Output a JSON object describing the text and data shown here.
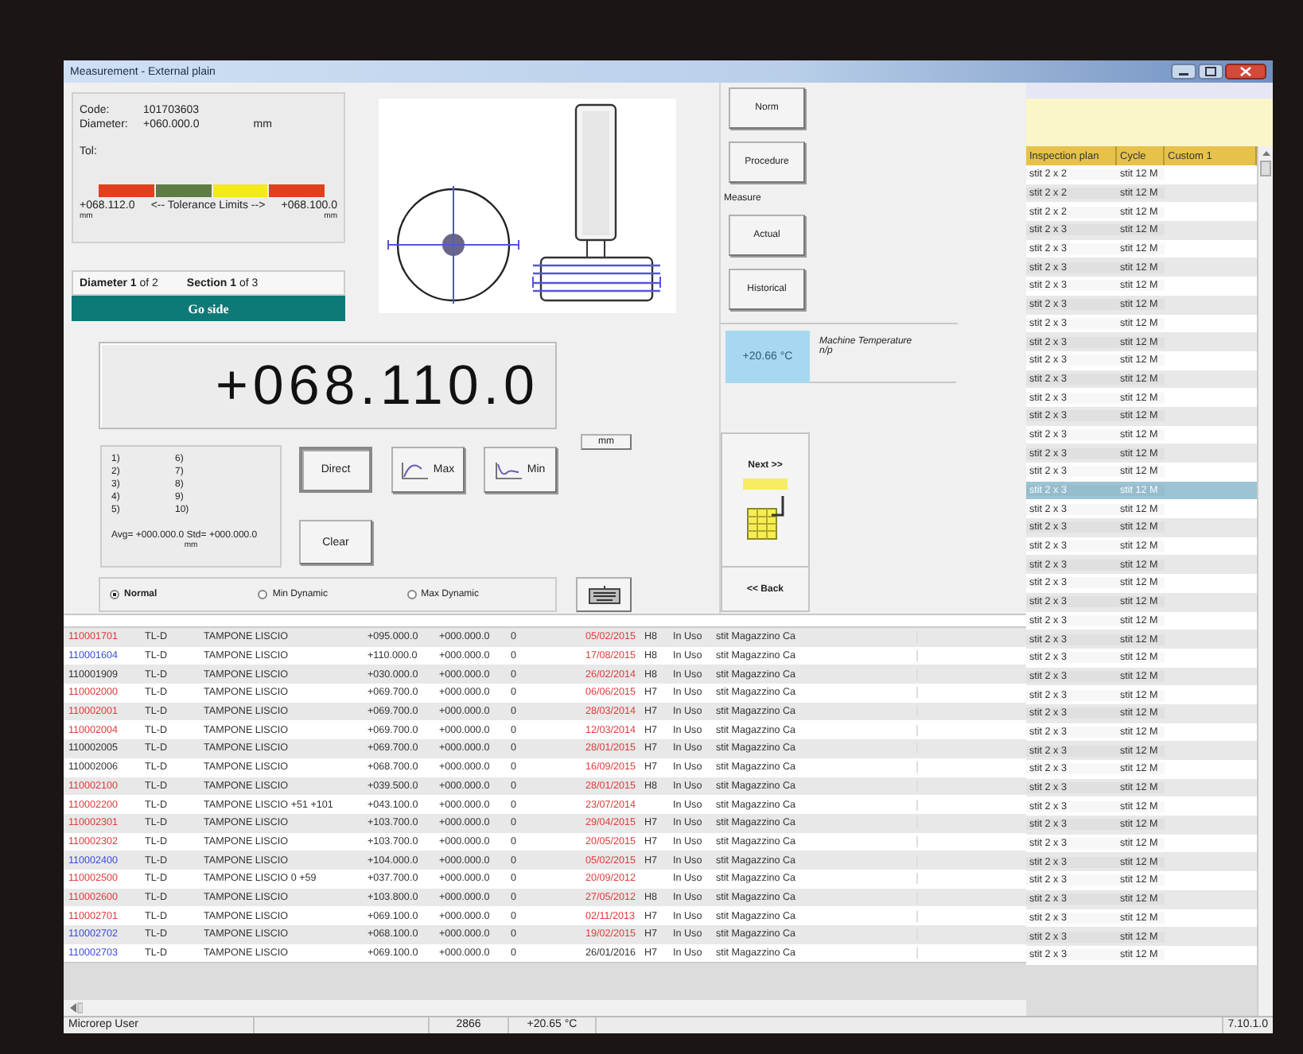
{
  "window": {
    "title": "Measurement - External plain"
  },
  "part": {
    "code_label": "Code:",
    "code": "101703603",
    "diameter_label": "Diameter:",
    "diameter": "+060.000.0",
    "unit": "mm",
    "tol_label": "Tol:"
  },
  "tolerance": {
    "lower": "+068.112.0",
    "lower_unit": "mm",
    "caption": "<-- Tolerance Limits -->",
    "upper": "+068.100.0",
    "upper_unit": "mm",
    "segments": [
      {
        "color": "#e0401c"
      },
      {
        "color": "#5e7c44"
      },
      {
        "color": "#f2ea1a"
      },
      {
        "color": "#e0401c"
      }
    ]
  },
  "position": {
    "diameter": "**Diameter 1** of 2",
    "section": "**Section 1** of 3"
  },
  "side": "Go side",
  "reading": "+068.110.0",
  "unit_button": "mm",
  "readings": {
    "slots": [
      "1)",
      "2)",
      "3)",
      "4)",
      "5)",
      "6)",
      "7)",
      "8)",
      "9)",
      "10)"
    ],
    "summary": "Avg= +000.000.0  Std= +000.000.0",
    "unit": "mm"
  },
  "mode_buttons": [
    {
      "label": "Direct",
      "kind": "plain",
      "selected": true
    },
    {
      "label": "Max",
      "kind": "max",
      "selected": false
    },
    {
      "label": "Min",
      "kind": "min",
      "selected": false
    },
    {
      "label": "Clear",
      "kind": "plain",
      "selected": false
    }
  ],
  "dynamics": [
    {
      "label": "Normal",
      "selected": true
    },
    {
      "label": "Min Dynamic",
      "selected": false
    },
    {
      "label": "Max Dynamic",
      "selected": false
    }
  ],
  "nav": [
    {
      "kind": "button",
      "label": "Norm"
    },
    {
      "kind": "button",
      "label": "Procedure"
    },
    {
      "kind": "label",
      "label": "Measure"
    },
    {
      "kind": "button",
      "label": "Actual"
    },
    {
      "kind": "button",
      "label": "Historical"
    }
  ],
  "temperature": {
    "value": "+20.66 °C",
    "label": "Machine Temperature",
    "note": "n/p"
  },
  "next": "Next >>",
  "back": "<< Back",
  "table": {
    "rows": [
      {
        "column_1": "110001701",
        "color": "#e03a3a",
        "column_2": "TL-D",
        "column_3": "TAMPONE LISCIO",
        "column_4": "+095.000.0",
        "column_5": "+000.000.0",
        "column_6": "0",
        "column_7": "05/02/2015",
        "expired": true,
        "column_8": "H8",
        "column_9": "In Uso",
        "column_10": "stit Magazzino Ca"
      },
      {
        "column_1": "110001604",
        "color": "#3a4ae0",
        "column_2": "TL-D",
        "column_3": "TAMPONE LISCIO",
        "column_4": "+110.000.0",
        "column_5": "+000.000.0",
        "column_6": "0",
        "column_7": "17/08/2015",
        "expired": true,
        "column_8": "H8",
        "column_9": "In Uso",
        "column_10": "stit Magazzino Ca"
      },
      {
        "column_1": "110001909",
        "color": "#333333",
        "column_2": "TL-D",
        "column_3": "TAMPONE LISCIO",
        "column_4": "+030.000.0",
        "column_5": "+000.000.0",
        "column_6": "0",
        "column_7": "26/02/2014",
        "expired": true,
        "column_8": "H8",
        "column_9": "In Uso",
        "column_10": "stit Magazzino Ca"
      },
      {
        "column_1": "110002000",
        "color": "#e03a3a",
        "column_2": "TL-D",
        "column_3": "TAMPONE LISCIO",
        "column_4": "+069.700.0",
        "column_5": "+000.000.0",
        "column_6": "0",
        "column_7": "06/06/2015",
        "expired": true,
        "column_8": "H7",
        "column_9": "In Uso",
        "column_10": "stit Magazzino Ca"
      },
      {
        "column_1": "110002001",
        "color": "#e03a3a",
        "column_2": "TL-D",
        "column_3": "TAMPONE LISCIO",
        "column_4": "+069.700.0",
        "column_5": "+000.000.0",
        "column_6": "0",
        "column_7": "28/03/2014",
        "expired": true,
        "column_8": "H7",
        "column_9": "In Uso",
        "column_10": "stit Magazzino Ca"
      },
      {
        "column_1": "110002004",
        "color": "#e03a3a",
        "column_2": "TL-D",
        "column_3": "TAMPONE LISCIO",
        "column_4": "+069.700.0",
        "column_5": "+000.000.0",
        "column_6": "0",
        "column_7": "12/03/2014",
        "expired": true,
        "column_8": "H7",
        "column_9": "In Uso",
        "column_10": "stit Magazzino Ca"
      },
      {
        "column_1": "110002005",
        "color": "#333333",
        "column_2": "TL-D",
        "column_3": "TAMPONE LISCIO",
        "column_4": "+069.700.0",
        "column_5": "+000.000.0",
        "column_6": "0",
        "column_7": "28/01/2015",
        "expired": true,
        "column_8": "H7",
        "column_9": "In Uso",
        "column_10": "stit Magazzino Ca"
      },
      {
        "column_1": "110002006",
        "color": "#333333",
        "column_2": "TL-D",
        "column_3": "TAMPONE LISCIO",
        "column_4": "+068.700.0",
        "column_5": "+000.000.0",
        "column_6": "0",
        "column_7": "16/09/2015",
        "expired": true,
        "column_8": "H7",
        "column_9": "In Uso",
        "column_10": "stit Magazzino Ca"
      },
      {
        "column_1": "110002100",
        "color": "#e03a3a",
        "column_2": "TL-D",
        "column_3": "TAMPONE LISCIO",
        "column_4": "+039.500.0",
        "column_5": "+000.000.0",
        "column_6": "0",
        "column_7": "28/01/2015",
        "expired": true,
        "column_8": "H8",
        "column_9": "In Uso",
        "column_10": "stit Magazzino Ca"
      },
      {
        "column_1": "110002200",
        "color": "#e03a3a",
        "column_2": "TL-D",
        "column_3": "TAMPONE LISCIO +51 +101",
        "column_4": "+043.100.0",
        "column_5": "+000.000.0",
        "column_6": "0",
        "column_7": "23/07/2014",
        "expired": true,
        "column_9": "In Uso",
        "column_10": "stit Magazzino Ca"
      },
      {
        "column_1": "110002301",
        "color": "#e03a3a",
        "column_2": "TL-D",
        "column_3": "TAMPONE LISCIO",
        "column_4": "+103.700.0",
        "column_5": "+000.000.0",
        "column_6": "0",
        "column_7": "29/04/2015",
        "expired": true,
        "column_8": "H7",
        "column_9": "In Uso",
        "column_10": "stit Magazzino Ca"
      },
      {
        "column_1": "110002302",
        "color": "#e03a3a",
        "column_2": "TL-D",
        "column_3": "TAMPONE LISCIO",
        "column_4": "+103.700.0",
        "column_5": "+000.000.0",
        "column_6": "0",
        "column_7": "20/05/2015",
        "expired": true,
        "column_8": "H7",
        "column_9": "In Uso",
        "column_10": "stit Magazzino Ca"
      },
      {
        "column_1": "110002400",
        "color": "#3a4ae0",
        "column_2": "TL-D",
        "column_3": "TAMPONE LISCIO",
        "column_4": "+104.000.0",
        "column_5": "+000.000.0",
        "column_6": "0",
        "column_7": "05/02/2015",
        "expired": true,
        "column_8": "H7",
        "column_9": "In Uso",
        "column_10": "stit Magazzino Ca"
      },
      {
        "column_1": "110002500",
        "color": "#e03a3a",
        "column_2": "TL-D",
        "column_3": "TAMPONE LISCIO 0 +59",
        "column_4": "+037.700.0",
        "column_5": "+000.000.0",
        "column_6": "0",
        "column_7": "20/09/2012",
        "expired": true,
        "column_9": "In Uso",
        "column_10": "stit Magazzino Ca"
      },
      {
        "column_1": "110002600",
        "color": "#e03a3a",
        "column_2": "TL-D",
        "column_3": "TAMPONE LISCIO",
        "column_4": "+103.800.0",
        "column_5": "+000.000.0",
        "column_6": "0",
        "column_7": "27/05/2012",
        "expired": true,
        "column_8": "H8",
        "column_9": "In Uso",
        "column_10": "stit Magazzino Ca"
      },
      {
        "column_1": "110002701",
        "color": "#e03a3a",
        "column_2": "TL-D",
        "column_3": "TAMPONE LISCIO",
        "column_4": "+069.100.0",
        "column_5": "+000.000.0",
        "column_6": "0",
        "column_7": "02/11/2013",
        "expired": true,
        "column_8": "H7",
        "column_9": "In Uso",
        "column_10": "stit Magazzino Ca"
      },
      {
        "column_1": "110002702",
        "color": "#3a4ae0",
        "column_2": "TL-D",
        "column_3": "TAMPONE LISCIO",
        "column_4": "+068.100.0",
        "column_5": "+000.000.0",
        "column_6": "0",
        "column_7": "19/02/2015",
        "expired": true,
        "column_8": "H7",
        "column_9": "In Uso",
        "column_10": "stit Magazzino Ca"
      },
      {
        "column_1": "110002703",
        "color": "#3a4ae0",
        "column_2": "TL-D",
        "column_3": "TAMPONE LISCIO",
        "column_4": "+069.100.0",
        "column_5": "+000.000.0",
        "column_6": "0",
        "column_7": "26/01/2016",
        "expired": false,
        "column_8": "H7",
        "column_9": "In Uso",
        "column_10": "stit Magazzino Ca"
      }
    ]
  },
  "plan": {
    "columns": [
      "Inspection plan",
      "Cycle",
      "Custom 1"
    ],
    "rows": [
      {
        "plan": "stit 2 x 2",
        "cycle": "stit 12 M",
        "selected": false
      },
      {
        "plan": "stit 2 x 2",
        "cycle": "stit 12 M",
        "selected": false
      },
      {
        "plan": "stit 2 x 2",
        "cycle": "stit 12 M",
        "selected": false
      },
      {
        "plan": "stit 2 x 3",
        "cycle": "stit 12 M",
        "selected": false
      },
      {
        "plan": "stit 2 x 3",
        "cycle": "stit 12 M",
        "selected": false
      },
      {
        "plan": "stit 2 x 3",
        "cycle": "stit 12 M",
        "selected": false
      },
      {
        "plan": "stit 2 x 3",
        "cycle": "stit 12 M",
        "selected": false
      },
      {
        "plan": "stit 2 x 3",
        "cycle": "stit 12 M",
        "selected": false
      },
      {
        "plan": "stit 2 x 3",
        "cycle": "stit 12 M",
        "selected": false
      },
      {
        "plan": "stit 2 x 3",
        "cycle": "stit 12 M",
        "selected": false
      },
      {
        "plan": "stit 2 x 3",
        "cycle": "stit 12 M",
        "selected": false
      },
      {
        "plan": "stit 2 x 3",
        "cycle": "stit 12 M",
        "selected": false
      },
      {
        "plan": "stit 2 x 3",
        "cycle": "stit 12 M",
        "selected": false
      },
      {
        "plan": "stit 2 x 3",
        "cycle": "stit 12 M",
        "selected": false
      },
      {
        "plan": "stit 2 x 3",
        "cycle": "stit 12 M",
        "selected": false
      },
      {
        "plan": "stit 2 x 3",
        "cycle": "stit 12 M",
        "selected": false
      },
      {
        "plan": "stit 2 x 3",
        "cycle": "stit 12 M",
        "selected": false
      },
      {
        "plan": "stit 2 x 3",
        "cycle": "stit 12 M",
        "selected": true
      },
      {
        "plan": "stit 2 x 3",
        "cycle": "stit 12 M",
        "selected": false
      },
      {
        "plan": "stit 2 x 3",
        "cycle": "stit 12 M",
        "selected": false
      },
      {
        "plan": "stit 2 x 3",
        "cycle": "stit 12 M",
        "selected": false
      },
      {
        "plan": "stit 2 x 3",
        "cycle": "stit 12 M",
        "selected": false
      },
      {
        "plan": "stit 2 x 3",
        "cycle": "stit 12 M",
        "selected": false
      },
      {
        "plan": "stit 2 x 3",
        "cycle": "stit 12 M",
        "selected": false
      },
      {
        "plan": "stit 2 x 3",
        "cycle": "stit 12 M",
        "selected": false
      },
      {
        "plan": "stit 2 x 3",
        "cycle": "stit 12 M",
        "selected": false
      },
      {
        "plan": "stit 2 x 3",
        "cycle": "stit 12 M",
        "selected": false
      },
      {
        "plan": "stit 2 x 3",
        "cycle": "stit 12 M",
        "selected": false
      },
      {
        "plan": "stit 2 x 3",
        "cycle": "stit 12 M",
        "selected": false
      },
      {
        "plan": "stit 2 x 3",
        "cycle": "stit 12 M",
        "selected": false
      },
      {
        "plan": "stit 2 x 3",
        "cycle": "stit 12 M",
        "selected": false
      },
      {
        "plan": "stit 2 x 3",
        "cycle": "stit 12 M",
        "selected": false
      },
      {
        "plan": "stit 2 x 3",
        "cycle": "stit 12 M",
        "selected": false
      },
      {
        "plan": "stit 2 x 3",
        "cycle": "stit 12 M",
        "selected": false
      },
      {
        "plan": "stit 2 x 3",
        "cycle": "stit 12 M",
        "selected": false
      },
      {
        "plan": "stit 2 x 3",
        "cycle": "stit 12 M",
        "selected": false
      },
      {
        "plan": "stit 2 x 3",
        "cycle": "stit 12 M",
        "selected": false
      },
      {
        "plan": "stit 2 x 3",
        "cycle": "stit 12 M",
        "selected": false
      },
      {
        "plan": "stit 2 x 3",
        "cycle": "stit 12 M",
        "selected": false
      },
      {
        "plan": "stit 2 x 3",
        "cycle": "stit 12 M",
        "selected": false
      },
      {
        "plan": "stit 2 x 3",
        "cycle": "stit 12 M",
        "selected": false
      },
      {
        "plan": "stit 2 x 3",
        "cycle": "stit 12 M",
        "selected": false
      },
      {
        "plan": "stit 2 x 3",
        "cycle": "stit 12 M",
        "selected": false
      }
    ]
  },
  "status_bar": {
    "user": "Microrep User",
    "count": "2866",
    "temperature": "+20.65 °C",
    "version": "7.10.1.0"
  }
}
